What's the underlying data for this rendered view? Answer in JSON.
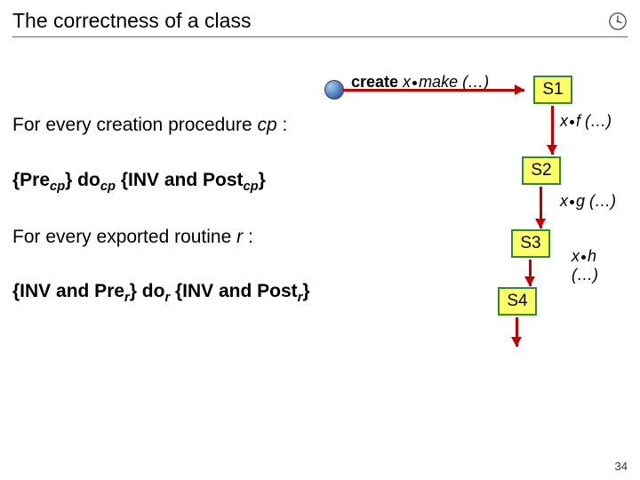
{
  "title": "The correctness of a class",
  "text": {
    "line1_a": "For every creation procedure ",
    "line1_cp": "cp",
    "line1_b": " :",
    "hoare1_a": "{Pre",
    "hoare1_b": "} do",
    "hoare1_c": " {INV and Post",
    "hoare1_d": "}",
    "line2_a": "For every exported routine ",
    "line2_r": "r",
    "line2_b": " :",
    "hoare2_a": "{INV and Pre",
    "hoare2_b": "} do",
    "hoare2_c": " {INV and Post",
    "hoare2_d": "}",
    "sub_cp": "cp",
    "sub_r": "r"
  },
  "diagram": {
    "create_a": "create",
    "create_b": " x",
    "create_c": "make (…)",
    "s1": "S1",
    "s2": "S2",
    "s3": "S3",
    "s4": "S4",
    "xf_a": "x",
    "xf_b": "f (…)",
    "xg_a": "x",
    "xg_b": "g (…)",
    "xh_a": "x",
    "xh_b": "h (…)"
  },
  "page": "34"
}
